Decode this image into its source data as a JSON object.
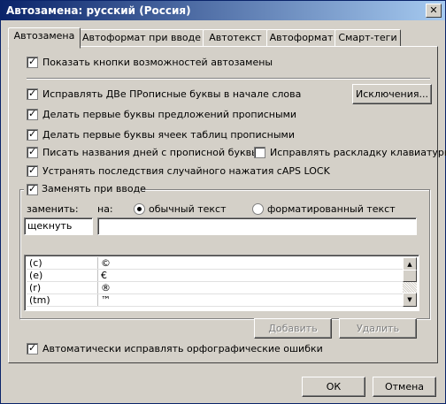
{
  "window": {
    "title": "Автозамена: русский (Россия)",
    "close_glyph": "✕"
  },
  "tabs": [
    {
      "label": "Автозамена"
    },
    {
      "label": "Автоформат при вводе"
    },
    {
      "label": "Автотекст"
    },
    {
      "label": "Автоформат"
    },
    {
      "label": "Смарт-теги"
    }
  ],
  "options": {
    "show_buttons": {
      "label": "Показать кнопки возможностей автозамены",
      "checked": true
    },
    "two_initial_caps": {
      "label": "Исправлять ДВе ПРописные буквы в начале слова",
      "checked": true
    },
    "capitalize_sentences": {
      "label": "Делать первые буквы предложений прописными",
      "checked": true
    },
    "capitalize_table_cells": {
      "label": "Делать первые буквы ячеек таблиц прописными",
      "checked": true
    },
    "capitalize_days": {
      "label": "Писать названия дней с прописной буквы",
      "checked": true
    },
    "fix_keyboard_layout": {
      "label": "Исправлять раскладку клавиатуры",
      "checked": false
    },
    "caps_lock": {
      "label": "Устранять последствия случайного нажатия cAPS LOCK",
      "checked": true
    },
    "replace_as_type": {
      "label": "Заменять при вводе",
      "checked": true
    },
    "auto_spelling": {
      "label": "Автоматически исправлять орфографические ошибки",
      "checked": true
    }
  },
  "exceptions_button": "Исключения...",
  "replace_label": "заменить:",
  "with_label": "на:",
  "radio_plain": {
    "label": "обычный текст",
    "selected": true
  },
  "radio_formatted": {
    "label": "форматированный текст",
    "selected": false
  },
  "replace_value": "щекнуть",
  "with_value": "",
  "list_rows": [
    {
      "from": "(c)",
      "to": "©"
    },
    {
      "from": "(e)",
      "to": "€"
    },
    {
      "from": "(r)",
      "to": "®"
    },
    {
      "from": "(tm)",
      "to": "™"
    }
  ],
  "add_button": "Добавить",
  "delete_button": "Удалить",
  "ok_button": "ОК",
  "cancel_button": "Отмена",
  "check_glyph": "✓",
  "scroll_up_glyph": "▲",
  "scroll_down_glyph": "▼"
}
